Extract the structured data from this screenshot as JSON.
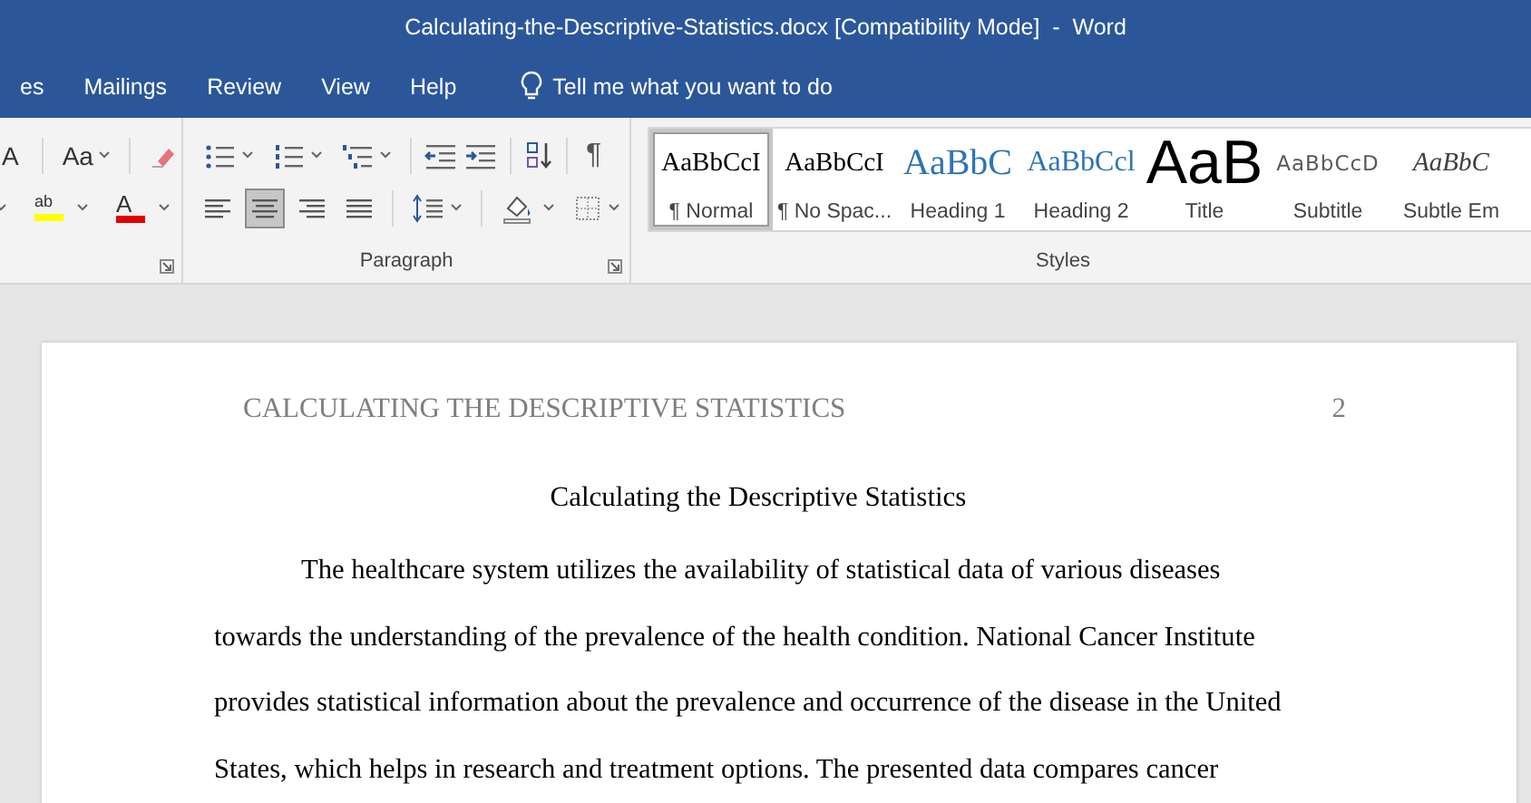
{
  "window": {
    "title": "Calculating-the-Descriptive-Statistics.docx [Compatibility Mode]  -  Word"
  },
  "ribbon_tabs": [
    {
      "label": "es",
      "selected": false
    },
    {
      "label": "Mailings",
      "selected": false
    },
    {
      "label": "Review",
      "selected": false
    },
    {
      "label": "View",
      "selected": false
    },
    {
      "label": "Help",
      "selected": false
    }
  ],
  "tell_me": {
    "placeholder": "Tell me what you want to do"
  },
  "font_group": {
    "grow_font": "A",
    "change_case": "Aa",
    "highlight": "ab",
    "font_color": "A"
  },
  "paragraph_group": {
    "label": "Paragraph",
    "show_marks": "¶",
    "alignments": [
      {
        "kind": "left",
        "selected": false
      },
      {
        "kind": "center",
        "selected": true
      },
      {
        "kind": "right",
        "selected": false
      },
      {
        "kind": "justify",
        "selected": false
      }
    ]
  },
  "styles_group": {
    "label": "Styles",
    "items": [
      {
        "kind": "normal",
        "preview": "AaBbCcI",
        "label": "¶ Normal",
        "selected": true
      },
      {
        "kind": "normal",
        "preview": "AaBbCcI",
        "label": "¶ No Spac...",
        "selected": false
      },
      {
        "kind": "heading1",
        "preview": "AaBbC",
        "label": "Heading 1",
        "selected": false
      },
      {
        "kind": "heading2",
        "preview": "AaBbCcl",
        "label": "Heading 2",
        "selected": false
      },
      {
        "kind": "title",
        "preview": "AaB",
        "label": "Title",
        "selected": false
      },
      {
        "kind": "subtitle",
        "preview": "AaBbCcD",
        "label": "Subtitle",
        "selected": false
      },
      {
        "kind": "emphasis",
        "preview": "AaBbC",
        "label": "Subtle Em",
        "selected": false
      }
    ]
  },
  "document": {
    "header": "CALCULATING THE DESCRIPTIVE STATISTICS",
    "page_number": "2",
    "title": "Calculating the Descriptive Statistics",
    "lines": [
      "The healthcare system utilizes the availability of statistical data of various diseases",
      "towards the understanding of the prevalence of the health condition. National Cancer Institute",
      "provides statistical information about the prevalence and occurrence of the disease in the United",
      "States, which helps in research and treatment options. The presented data compares cancer"
    ]
  }
}
